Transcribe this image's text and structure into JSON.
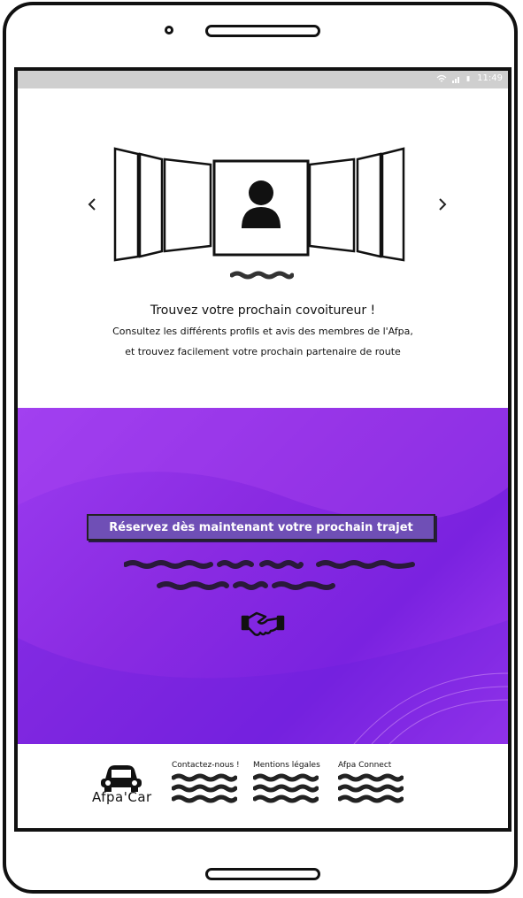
{
  "status_bar": {
    "time": "11:49"
  },
  "carousel": {
    "title": "Trouvez votre prochain covoitureur !",
    "description_line1": "Consultez les différents profils et avis des membres de l'Afpa,",
    "description_line2": "et trouvez facilement votre prochain partenaire de route",
    "prev_icon": "chevron-left-icon",
    "next_icon": "chevron-right-icon"
  },
  "hero": {
    "cta_label": "Réservez dès maintenant votre prochain trajet",
    "icon": "handshake-icon",
    "gradient_colors": [
      "#9b3cf0",
      "#7a22e0"
    ]
  },
  "footer": {
    "logo_text": "Afpa'Car",
    "columns": [
      {
        "heading": "Contactez-nous !"
      },
      {
        "heading": "Mentions légales"
      },
      {
        "heading": "Afpa Connect"
      }
    ]
  }
}
